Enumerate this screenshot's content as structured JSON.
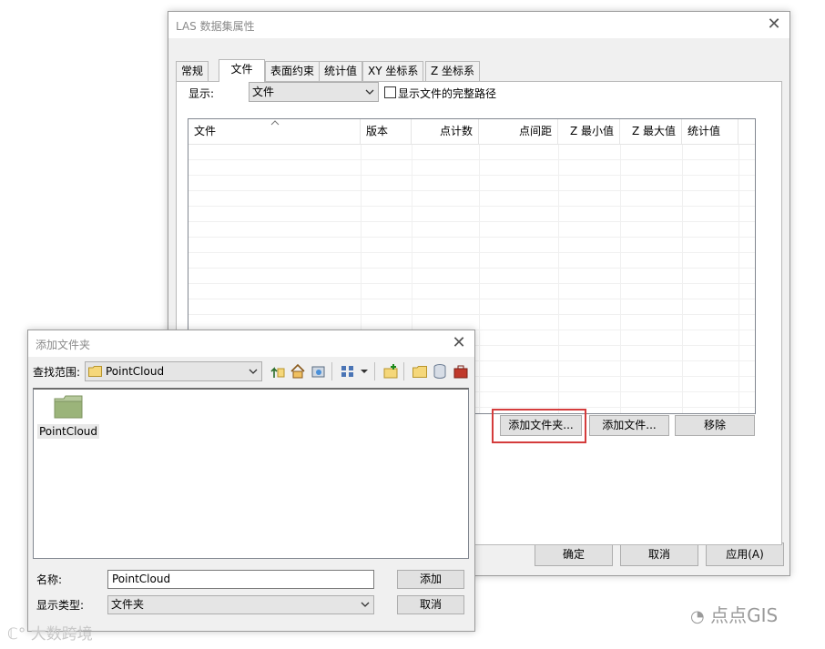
{
  "main_dialog": {
    "title": "LAS 数据集属性",
    "tabs": [
      "常规",
      "文件",
      "表面约束",
      "统计值",
      "XY 坐标系",
      "Z 坐标系"
    ],
    "active_tab_index": 1,
    "display_label": "显示:",
    "display_value": "文件",
    "show_full_path_label": "显示文件的完整路径",
    "show_full_path_checked": false,
    "columns": [
      "文件",
      "版本",
      "点计数",
      "点间距",
      "Z 最小值",
      "Z 最大值",
      "统计值"
    ],
    "buttons": {
      "add_folder": "添加文件夹...",
      "add_file": "添加文件...",
      "remove": "移除",
      "ok": "确定",
      "cancel": "取消",
      "apply": "应用(A)"
    }
  },
  "add_folder_dialog": {
    "title": "添加文件夹",
    "look_in_label": "查找范围:",
    "look_in_value": "PointCloud",
    "items": [
      {
        "name": "PointCloud",
        "icon": "folder-icon"
      }
    ],
    "name_label": "名称:",
    "name_value": "PointCloud",
    "type_label": "显示类型:",
    "type_value": "文件夹",
    "buttons": {
      "add": "添加",
      "cancel": "取消"
    },
    "toolbar_icons": [
      "up-one-level-icon",
      "home-icon",
      "connect-folder-icon",
      "view-icon",
      "view-dropdown-icon",
      "add-to-catalog-icon",
      "new-folder-icon",
      "database-icon",
      "toolbox-icon"
    ]
  },
  "watermarks": {
    "bottom_right": "点点GIS",
    "bottom_left": "大数跨境"
  },
  "colors": {
    "highlight": "#d43c3c",
    "folder": "#9bb47a"
  }
}
